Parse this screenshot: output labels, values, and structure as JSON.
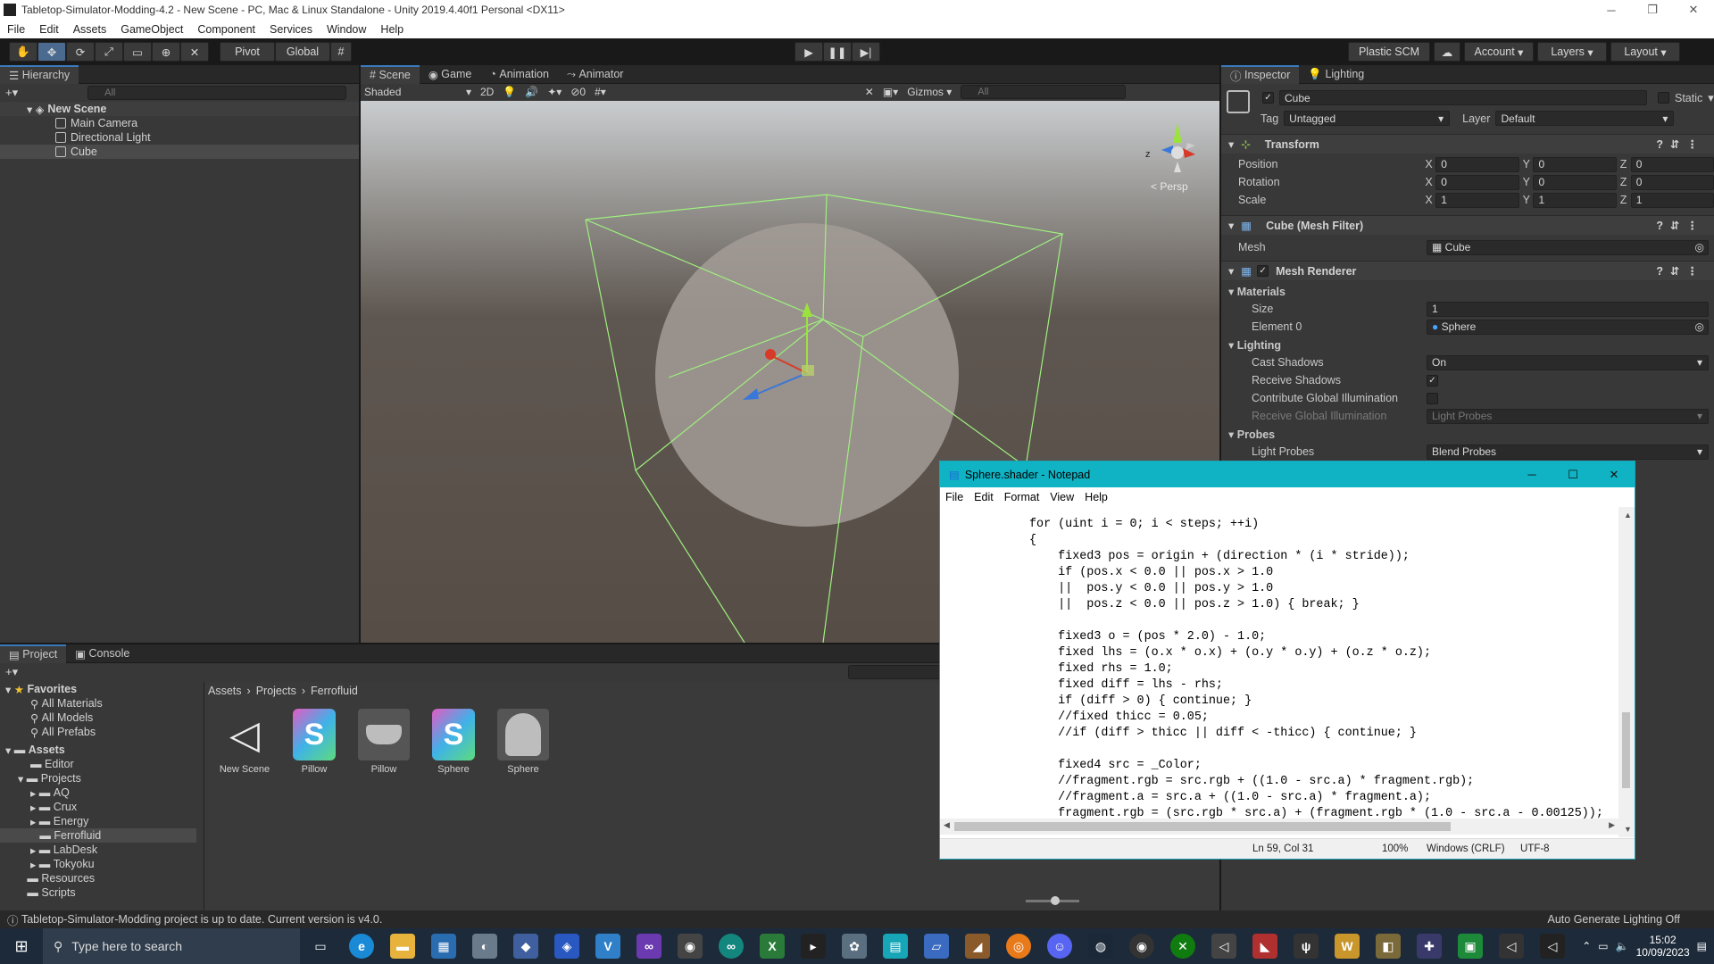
{
  "window": {
    "title": "Tabletop-Simulator-Modding-4.2 - New Scene - PC, Mac & Linux Standalone - Unity 2019.4.40f1 Personal <DX11>"
  },
  "menubar": [
    "File",
    "Edit",
    "Assets",
    "GameObject",
    "Component",
    "Services",
    "Window",
    "Help"
  ],
  "toolbar": {
    "pivot": "Pivot",
    "global": "Global",
    "plastic": "Plastic SCM",
    "account": "Account",
    "layers": "Layers",
    "layout": "Layout"
  },
  "hierarchy": {
    "tab": "Hierarchy",
    "search_placeholder": "All",
    "scene": "New Scene",
    "items": [
      "Main Camera",
      "Directional Light",
      "Cube"
    ]
  },
  "scene_view": {
    "tabs": [
      "Scene",
      "Game",
      "Animation",
      "Animator"
    ],
    "shading": "Shaded",
    "mode2d": "2D",
    "hidden_count": "0",
    "gizmos": "Gizmos",
    "search_placeholder": "All",
    "persp": "< Persp"
  },
  "inspector": {
    "tabs": [
      "Inspector",
      "Lighting"
    ],
    "object_name": "Cube",
    "static_label": "Static",
    "tag_label": "Tag",
    "tag_value": "Untagged",
    "layer_label": "Layer",
    "layer_value": "Default",
    "transform": {
      "title": "Transform",
      "position": {
        "label": "Position",
        "x": "0",
        "y": "0",
        "z": "0"
      },
      "rotation": {
        "label": "Rotation",
        "x": "0",
        "y": "0",
        "z": "0"
      },
      "scale": {
        "label": "Scale",
        "x": "1",
        "y": "1",
        "z": "1"
      }
    },
    "mesh_filter": {
      "title": "Cube (Mesh Filter)",
      "mesh_label": "Mesh",
      "mesh_value": "Cube"
    },
    "mesh_renderer": {
      "title": "Mesh Renderer",
      "materials": "Materials",
      "size_label": "Size",
      "size_value": "1",
      "element0_label": "Element 0",
      "element0_value": "Sphere",
      "lighting": "Lighting",
      "cast_shadows_label": "Cast Shadows",
      "cast_shadows_value": "On",
      "receive_shadows_label": "Receive Shadows",
      "contribute_gi_label": "Contribute Global Illumination",
      "receive_gi_label": "Receive Global Illumination",
      "receive_gi_value": "Light Probes",
      "probes": "Probes",
      "light_probes_label": "Light Probes",
      "light_probes_value": "Blend Probes"
    }
  },
  "project": {
    "tabs": [
      "Project",
      "Console"
    ],
    "favorites": {
      "label": "Favorites",
      "items": [
        "All Materials",
        "All Models",
        "All Prefabs"
      ]
    },
    "assets": {
      "label": "Assets",
      "items": [
        "Editor",
        "Projects",
        "AQ",
        "Crux",
        "Energy",
        "Ferrofluid",
        "LabDesk",
        "Tokyoku",
        "Resources",
        "Scripts"
      ]
    },
    "breadcrumb": [
      "Assets",
      "Projects",
      "Ferrofluid"
    ],
    "files": [
      {
        "name": "New Scene",
        "icon": "unity-scene-icon"
      },
      {
        "name": "Pillow",
        "icon": "shader-icon"
      },
      {
        "name": "Pillow",
        "icon": "material-icon"
      },
      {
        "name": "Sphere",
        "icon": "shader-icon"
      },
      {
        "name": "Sphere",
        "icon": "material-icon"
      }
    ]
  },
  "status_bar": {
    "message": "Tabletop-Simulator-Modding project is up to date. Current version is v4.0.",
    "right": "Auto Generate Lighting Off"
  },
  "notepad": {
    "title": "Sphere.shader - Notepad",
    "menu": [
      "File",
      "Edit",
      "Format",
      "View",
      "Help"
    ],
    "lines": [
      "for (uint i = 0; i < steps; ++i)",
      "{",
      "    fixed3 pos = origin + (direction * (i * stride));",
      "    if (pos.x < 0.0 || pos.x > 1.0",
      "    ||  pos.y < 0.0 || pos.y > 1.0",
      "    ||  pos.z < 0.0 || pos.z > 1.0) { break; }",
      "",
      "    fixed3 o = (pos * 2.0) - 1.0;",
      "    fixed lhs = (o.x * o.x) + (o.y * o.y) + (o.z * o.z);",
      "    fixed rhs = 1.0;",
      "    fixed diff = lhs - rhs;",
      "    if (diff > 0) { continue; }",
      "    //fixed thicc = 0.05;",
      "    //if (diff > thicc || diff < -thicc) { continue; }",
      "",
      "    fixed4 src = _Color;",
      "    //fragment.rgb = src.rgb + ((1.0 - src.a) * fragment.rgb);",
      "    //fragment.a = src.a + ((1.0 - src.a) * fragment.a);",
      "    fragment.rgb = (src.rgb * src.a) + (fragment.rgb * (1.0 - src.a - 0.00125));"
    ],
    "status": {
      "position": "Ln 59, Col 31",
      "zoom": "100%",
      "eol": "Windows (CRLF)",
      "encoding": "UTF-8"
    }
  },
  "taskbar": {
    "search_placeholder": "Type here to search",
    "time": "15:02",
    "date": "10/09/2023"
  }
}
